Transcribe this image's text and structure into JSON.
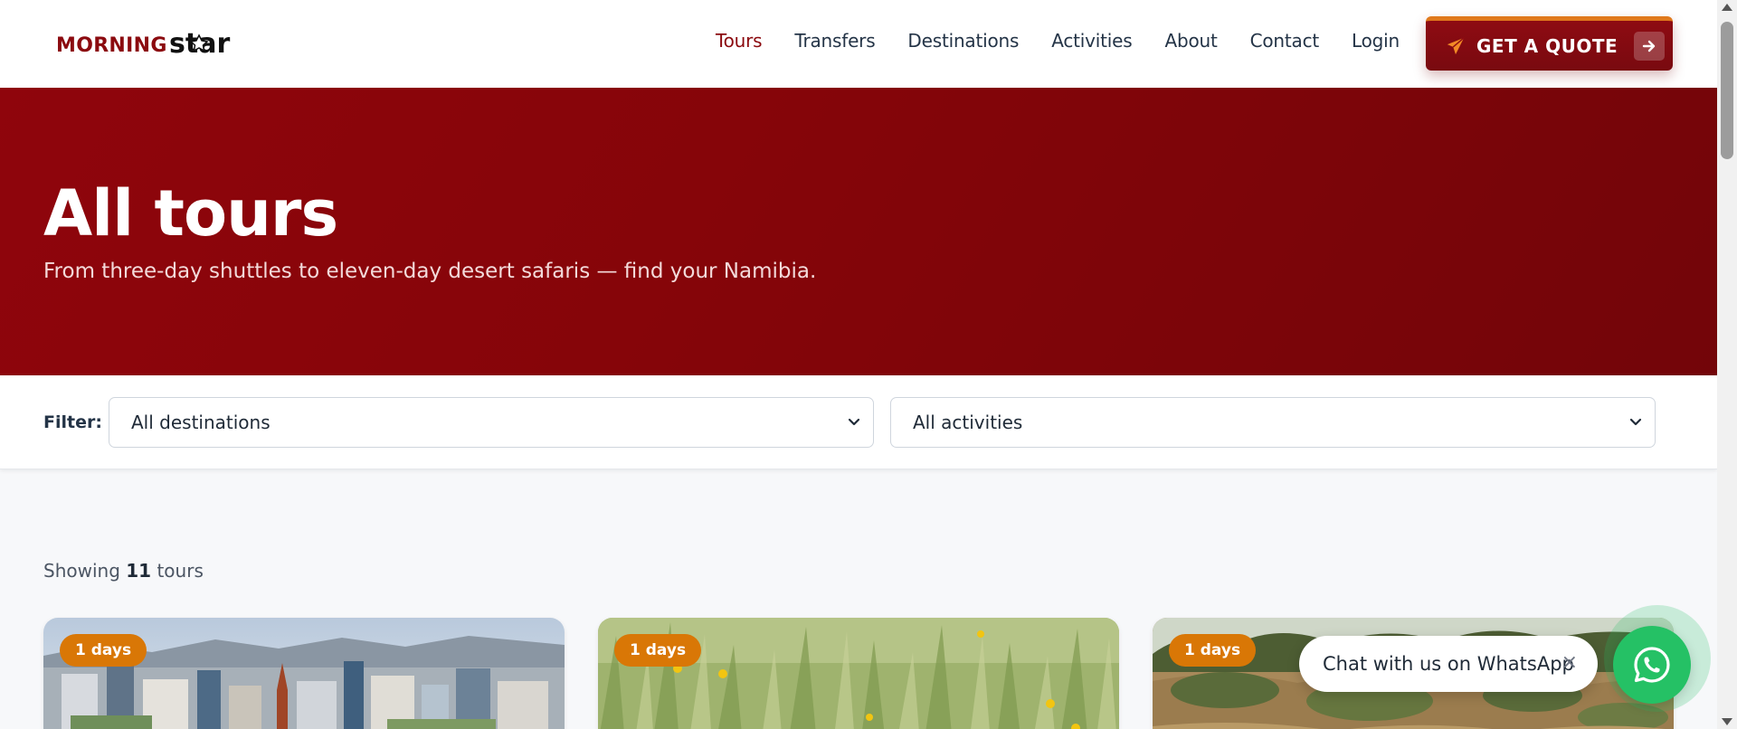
{
  "brand": {
    "name_text": "MORNING",
    "mark_text": "star",
    "accent_color": "#8b0a0f",
    "highlight_color": "#e0791c"
  },
  "nav": {
    "items": [
      {
        "label": "Tours",
        "active": true
      },
      {
        "label": "Transfers",
        "active": false
      },
      {
        "label": "Destinations",
        "active": false
      },
      {
        "label": "Activities",
        "active": false
      },
      {
        "label": "About",
        "active": false
      },
      {
        "label": "Contact",
        "active": false
      },
      {
        "label": "Login",
        "active": false
      }
    ],
    "cta_label": "GET A QUOTE",
    "cta_icons": [
      "paper-plane-icon",
      "arrow-right-icon"
    ]
  },
  "hero": {
    "title": "All tours",
    "subtitle": "From three-day shuttles to eleven-day desert safaris — find your Namibia."
  },
  "filter": {
    "label": "Filter:",
    "destination_selected": "All destinations",
    "activity_selected": "All activities"
  },
  "results": {
    "prefix": "Showing",
    "count": "11",
    "suffix": "tours"
  },
  "cards": [
    {
      "badge": "1 days",
      "image": "city-skyline-photo"
    },
    {
      "badge": "1 days",
      "image": "grassland-flowers-photo"
    },
    {
      "badge": "1 days",
      "image": "savanna-bush-photo"
    }
  ],
  "whatsapp": {
    "bubble_text": "Chat with us on WhatsApp",
    "close_glyph": "×",
    "button_color": "#25c165",
    "icon": "whatsapp-icon"
  }
}
